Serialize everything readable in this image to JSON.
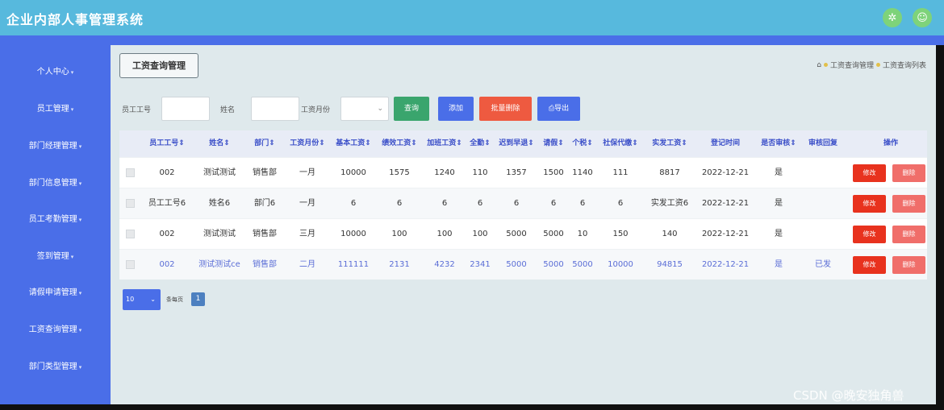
{
  "app": {
    "title": "企业内部人事管理系统"
  },
  "header": {
    "icons": [
      "settings-icon",
      "user-icon"
    ]
  },
  "sidebar": {
    "items": [
      {
        "label": "个人中心"
      },
      {
        "label": "员工管理"
      },
      {
        "label": "部门经理管理"
      },
      {
        "label": "部门信息管理"
      },
      {
        "label": "员工考勤管理"
      },
      {
        "label": "签到管理"
      },
      {
        "label": "请假申请管理"
      },
      {
        "label": "工资查询管理"
      },
      {
        "label": "部门类型管理"
      }
    ]
  },
  "page": {
    "title": "工资查询管理",
    "breadcrumb": [
      "工资查询管理",
      "工资查询列表"
    ]
  },
  "search": {
    "employee_id_label": "员工工号",
    "employee_id_value": "",
    "name_label": "姓名",
    "name_value": "",
    "month_label": "工资月份",
    "month_value": ""
  },
  "toolbar": {
    "query_label": "查询",
    "add_label": "添加",
    "batch_delete_label": "批量删除",
    "export_label": "导出"
  },
  "table": {
    "columns": [
      "员工工号",
      "姓名",
      "部门",
      "工资月份",
      "基本工资",
      "绩效工资",
      "加班工资",
      "全勤",
      "迟到早退",
      "请假",
      "个税",
      "社保代缴",
      "实发工资",
      "登记时间",
      "是否审核",
      "审核回复",
      "操作"
    ],
    "rows": [
      [
        "002",
        "测试测试",
        "销售部",
        "一月",
        "10000",
        "1575",
        "1240",
        "110",
        "1357",
        "1500",
        "1140",
        "111",
        "8817",
        "2022-12-21",
        "是",
        ""
      ],
      [
        "员工工号6",
        "姓名6",
        "部门6",
        "一月",
        "6",
        "6",
        "6",
        "6",
        "6",
        "6",
        "6",
        "6",
        "实发工资6",
        "2022-12-21",
        "是",
        ""
      ],
      [
        "002",
        "测试测试",
        "销售部",
        "三月",
        "10000",
        "100",
        "100",
        "100",
        "5000",
        "5000",
        "10",
        "150",
        "140",
        "2022-12-21",
        "是",
        ""
      ],
      [
        "002",
        "测试测试ce",
        "销售部",
        "二月",
        "111111",
        "2131",
        "4232",
        "2341",
        "5000",
        "5000",
        "5000",
        "10000",
        "94815",
        "2022-12-21",
        "是",
        "已发"
      ]
    ],
    "edit_label": "修改",
    "delete_label": "删除"
  },
  "pagination": {
    "page_size": "10",
    "per_page_label": "条每页",
    "current_page": "1"
  },
  "watermark": "CSDN @晚安独角兽",
  "colors": {
    "header": "#57b9dd",
    "sidebar": "#4a6ee8",
    "query": "#3aa56d",
    "add": "#4a6ee8",
    "batch_delete": "#ee5a40",
    "export": "#4a6ee8",
    "edit": "#e8321e",
    "delete": "#f06e6a"
  }
}
